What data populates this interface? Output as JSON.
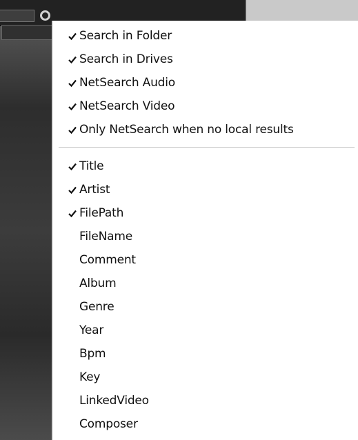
{
  "menu": {
    "group1": [
      {
        "label": "Search in Folder",
        "checked": true
      },
      {
        "label": "Search in Drives",
        "checked": true
      },
      {
        "label": "NetSearch Audio",
        "checked": true
      },
      {
        "label": "NetSearch Video",
        "checked": true
      },
      {
        "label": "Only NetSearch when no local results",
        "checked": true
      }
    ],
    "group2": [
      {
        "label": "Title",
        "checked": true
      },
      {
        "label": "Artist",
        "checked": true
      },
      {
        "label": "FilePath",
        "checked": true
      },
      {
        "label": "FileName",
        "checked": false
      },
      {
        "label": "Comment",
        "checked": false
      },
      {
        "label": "Album",
        "checked": false
      },
      {
        "label": "Genre",
        "checked": false
      },
      {
        "label": "Year",
        "checked": false
      },
      {
        "label": "Bpm",
        "checked": false
      },
      {
        "label": "Key",
        "checked": false
      },
      {
        "label": "LinkedVideo",
        "checked": false
      },
      {
        "label": "Composer",
        "checked": false
      }
    ]
  },
  "icons": {
    "checkmark": "checkmark-icon",
    "search": "search-icon"
  },
  "colors": {
    "menu_bg": "#ffffff",
    "text": "#111111",
    "app_bg": "#2a2a2a"
  }
}
